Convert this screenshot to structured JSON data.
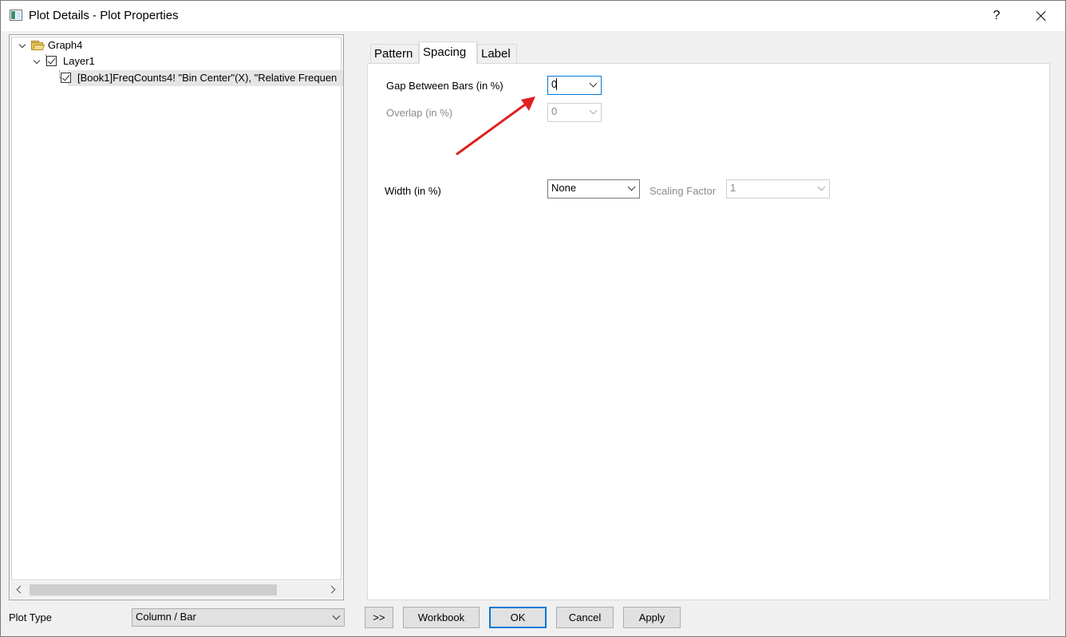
{
  "window": {
    "title": "Plot Details - Plot Properties"
  },
  "tree": {
    "items": [
      {
        "label": "Graph4",
        "level": 0,
        "type": "folder"
      },
      {
        "label": "Layer1",
        "level": 1,
        "type": "checked"
      },
      {
        "label": "[Book1]FreqCounts4! \"Bin Center\"(X), \"Relative Frequen",
        "level": 2,
        "type": "checked",
        "selected": true
      }
    ]
  },
  "plot_type": {
    "label": "Plot Type",
    "value": "Column / Bar"
  },
  "tabs": [
    {
      "label": "Pattern",
      "active": false
    },
    {
      "label": "Spacing",
      "active": true
    },
    {
      "label": "Label",
      "active": false
    }
  ],
  "spacing": {
    "gap_label": "Gap Between Bars (in %)",
    "gap_value": "0",
    "overlap_label": "Overlap (in %)",
    "overlap_value": "0",
    "width_label": "Width (in %)",
    "width_value": "None",
    "scaling_label": "Scaling Factor",
    "scaling_value": "1"
  },
  "buttons": {
    "expand": ">>",
    "workbook": "Workbook",
    "ok": "OK",
    "cancel": "Cancel",
    "apply": "Apply"
  },
  "colors": {
    "accent": "#0078d7",
    "annotation_arrow": "#e02020",
    "tree_folder": "#e8c35a"
  },
  "icons": [
    "app-icon",
    "help-icon",
    "close-icon",
    "chevron-down-icon",
    "folder-icon",
    "checkbox-icon",
    "scroll-left-icon",
    "scroll-right-icon"
  ]
}
